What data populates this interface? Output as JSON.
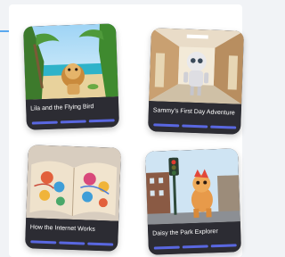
{
  "cards": [
    {
      "title": "Lila and the Flying Bird",
      "illustration": "lion-on-beach",
      "progress_segments": 3
    },
    {
      "title": "Sammy's First Day Adventure",
      "illustration": "robot-in-school-hallway",
      "progress_segments": 3
    },
    {
      "title": "How the Internet Works",
      "illustration": "open-colorful-book",
      "progress_segments": 3
    },
    {
      "title": "Daisy the Park Explorer",
      "illustration": "dinosaur-in-city-street",
      "progress_segments": 3
    }
  ],
  "colors": {
    "background": "#f1f3f6",
    "card": "#2c2c33",
    "progress": "#5967e0",
    "accent": "#5aa8ef"
  }
}
